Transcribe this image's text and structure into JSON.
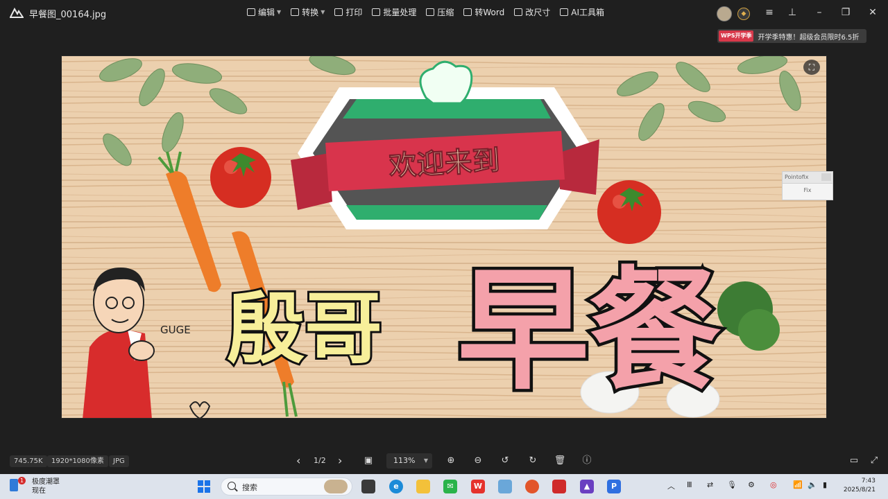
{
  "window": {
    "title": "早餐图_00164.jpg"
  },
  "toolbar": {
    "items": [
      {
        "label": "编辑",
        "icon": "edit-icon",
        "dropdown": true
      },
      {
        "label": "转换",
        "icon": "convert-icon",
        "dropdown": true
      },
      {
        "label": "打印",
        "icon": "print-icon",
        "dropdown": false
      },
      {
        "label": "批量处理",
        "icon": "batch-icon",
        "dropdown": false
      },
      {
        "label": "压缩",
        "icon": "compress-icon",
        "dropdown": false
      },
      {
        "label": "转Word",
        "icon": "word-icon",
        "dropdown": false
      },
      {
        "label": "改尺寸",
        "icon": "resize-icon",
        "dropdown": false
      },
      {
        "label": "AI工具箱",
        "icon": "ai-icon",
        "dropdown": false
      }
    ]
  },
  "promo": {
    "tag": "WPS开学季",
    "text": "开学季特惠！超级会员限时6.5折"
  },
  "image": {
    "banner_text": "欢迎来到",
    "main_left": "殷哥",
    "main_right": "早餐",
    "caption": "GUGE",
    "colors": {
      "wood": "#e8c9a5",
      "pink": "#f4a1aa",
      "yellow": "#f7ef9a",
      "green": "#2fae6e",
      "red_ribbon": "#d8344c"
    }
  },
  "pointofix": {
    "title": "Pointofix",
    "body": "Fix"
  },
  "statusbar": {
    "size": "745.75K",
    "dimensions": "1920*1080像素",
    "format": "JPG",
    "page": "1/2",
    "zoom": "113%"
  },
  "taskbar": {
    "weather_title": "极度潮罩",
    "weather_sub": "现在",
    "badge": "1",
    "search_placeholder": "搜索",
    "time": "7:43",
    "date": "2025/8/21"
  }
}
